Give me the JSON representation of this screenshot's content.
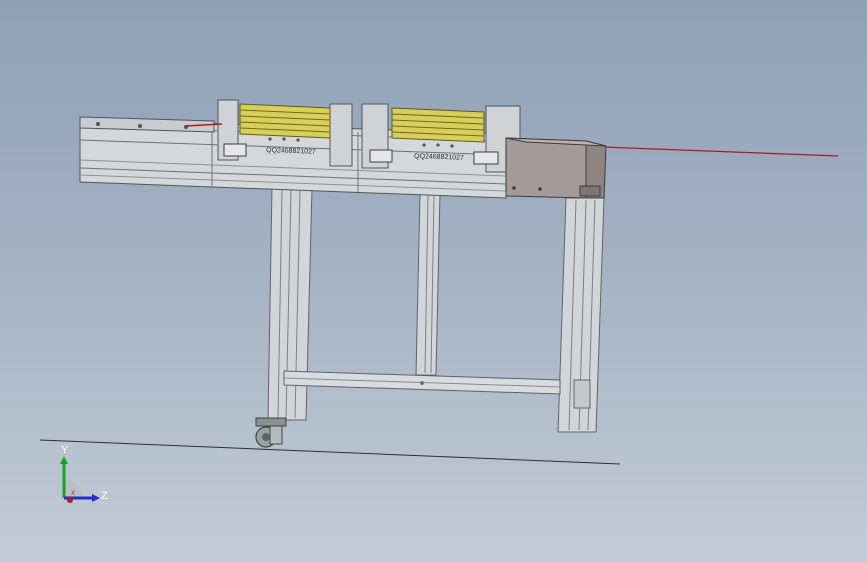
{
  "model": {
    "part_label_left": "QQ2468821027",
    "part_label_right": "QQ2468821027"
  },
  "triad": {
    "axis_y": "Y",
    "axis_z": "Z",
    "axis_x": "X"
  },
  "colors": {
    "frame_gray": "#cfd3d6",
    "frame_dark": "#6d7478",
    "rail_yellow": "#d8cf58",
    "motor_housing": "#a49a97",
    "axis_red": "#b21a1a",
    "axis_green": "#16a321",
    "axis_blue": "#1f2fcf",
    "ground_line": "#2c2f33"
  }
}
